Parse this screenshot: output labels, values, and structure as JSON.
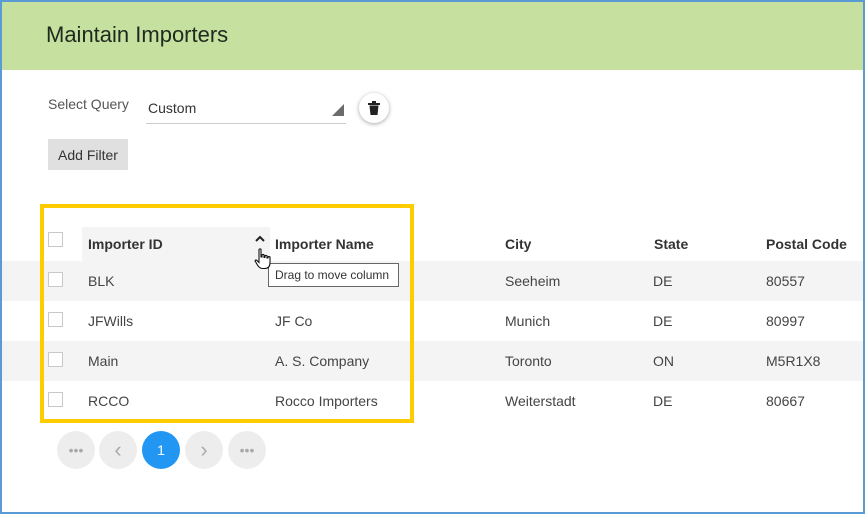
{
  "header": {
    "title": "Maintain Importers",
    "bg_color": "#c5e09f"
  },
  "query": {
    "label": "Select Query",
    "selected": "Custom"
  },
  "toolbar": {
    "add_filter_label": "Add Filter"
  },
  "table": {
    "columns": [
      "Importer ID",
      "Importer Name",
      "City",
      "State",
      "Postal Code"
    ],
    "sorted_column": "Importer ID",
    "sort_direction": "ascending",
    "rows": [
      {
        "id": "BLK",
        "name": "",
        "city": "Seeheim",
        "state": "DE",
        "postal": "80557"
      },
      {
        "id": "JFWills",
        "name": "JF Co",
        "city": "Munich",
        "state": "DE",
        "postal": "80997"
      },
      {
        "id": "Main",
        "name": "A. S. Company",
        "city": "Toronto",
        "state": "ON",
        "postal": "M5R1X8"
      },
      {
        "id": "RCCO",
        "name": "Rocco Importers",
        "city": "Weiterstadt",
        "state": "DE",
        "postal": "80667"
      }
    ]
  },
  "tooltip": {
    "text": "Drag to move column"
  },
  "pager": {
    "current_page": "1",
    "first": "•••",
    "prev": "‹",
    "next": "›",
    "last": "•••"
  },
  "colors": {
    "highlight": "#ffcc00",
    "accent": "#2196f3"
  }
}
